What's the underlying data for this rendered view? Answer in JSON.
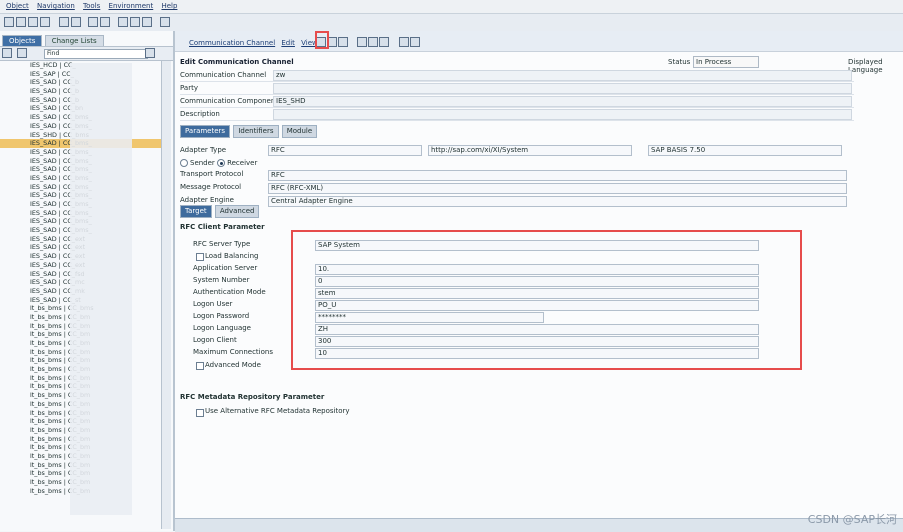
{
  "menu": [
    "Object",
    "Navigation",
    "Tools",
    "Environment",
    "Help"
  ],
  "left": {
    "tabs": [
      "Objects",
      "Change Lists"
    ],
    "find": "Find",
    "items": [
      "IES_HCD | CC_",
      "IES_SAP | CC_",
      "IES_SAD | CC_b",
      "IES_SAD | CC_b",
      "IES_SAD | CC_b",
      "IES_SAD | CC_bn",
      "IES_SAD | CC_bms_",
      "IES_SAD | CC_bms_",
      "IES_SHD | CC_bms",
      "IES_SAD | CC_bms_",
      "IES_SAD | CC_bms_",
      "IES_SAD | CC_bms_",
      "IES_SAD | CC_bms_",
      "IES_SAD | CC_bms_",
      "IES_SAD | CC_bms_",
      "IES_SAD | CC_bms_",
      "IES_SAD | CC_bms_",
      "IES_SAD | CC_bms_",
      "IES_SAD | CC_bms_",
      "IES_SAD | CC_bms_",
      "IES_SAD | CC_ext",
      "IES_SAD | CC_ext",
      "IES_SAD | CC_ext",
      "IES_SAD | CC_ext",
      "IES_SAD | CC_fsd",
      "IES_SAD | CC_mc",
      "IES_SAD | CC_mk",
      "IES_SAD | CC_st",
      "lt_bs_bms | CC_bms",
      "lt_bs_bms | CC_bm",
      "lt_bs_bms | CC_bm",
      "lt_bs_bms | CC_bm",
      "lt_bs_bms | CC_bm",
      "lt_bs_bms | CC_bm",
      "lt_bs_bms | CC_bm",
      "lt_bs_bms | CC_bm",
      "lt_bs_bms | CC_bm",
      "lt_bs_bms | CC_bm",
      "lt_bs_bms | CC_bm",
      "lt_bs_bms | CC_bm",
      "lt_bs_bms | CC_bm",
      "lt_bs_bms | CC_bm",
      "lt_bs_bms | CC_bm",
      "lt_bs_bms | CC_bm",
      "lt_bs_bms | CC_bm",
      "lt_bs_bms | CC_bm",
      "lt_bs_bms | CC_bm",
      "lt_bs_bms | CC_bm",
      "lt_bs_bms | CC_bm",
      "lt_bs_bms | CC_bm"
    ],
    "selected_index": 9
  },
  "main": {
    "menu": [
      "Communication Channel",
      "Edit",
      "View"
    ],
    "title": "Edit Communication Channel",
    "status_label": "Status",
    "status_value": "In Process",
    "language": "Displayed Language",
    "rows": [
      {
        "label": "Communication Channel",
        "value": "zw"
      },
      {
        "label": "Party",
        "value": ""
      },
      {
        "label": "Communication Component",
        "value": "IES_SHD"
      },
      {
        "label": "Description",
        "value": ""
      }
    ],
    "tabs": [
      "Parameters",
      "Identifiers",
      "Module"
    ],
    "adapter_type_label": "Adapter Type",
    "adapter_type": "RFC",
    "adapter_ns": "http://sap.com/xi/XI/System",
    "adapter_version": "SAP BASIS 7.50",
    "sender": "Sender",
    "receiver": "Receiver",
    "transport_label": "Transport Protocol",
    "transport": "RFC",
    "message_label": "Message Protocol",
    "message": "RFC (RFC-XML)",
    "engine_label": "Adapter Engine",
    "engine": "Central Adapter Engine",
    "subtabs": [
      "Target",
      "Advanced"
    ],
    "section_title": "RFC Client Parameter",
    "rfc_fields": [
      {
        "label": "RFC Server Type",
        "value": "SAP System"
      },
      {
        "label": "Load Balancing",
        "value": ""
      },
      {
        "label": "Application Server",
        "value": "10."
      },
      {
        "label": "System Number",
        "value": "0"
      },
      {
        "label": "Authentication Mode",
        "value": "stem"
      },
      {
        "label": "Logon User",
        "value": "PO_U"
      },
      {
        "label": "Logon Password",
        "value": "********"
      },
      {
        "label": "Logon Language",
        "value": "ZH"
      },
      {
        "label": "Logon Client",
        "value": "300"
      },
      {
        "label": "Maximum Connections",
        "value": "10"
      },
      {
        "label": "Advanced Mode",
        "value": ""
      }
    ],
    "repo_title": "RFC Metadata Repository Parameter",
    "repo_checkbox": "Use Alternative RFC Metadata Repository",
    "watermark": "CSDN @SAP长河"
  }
}
